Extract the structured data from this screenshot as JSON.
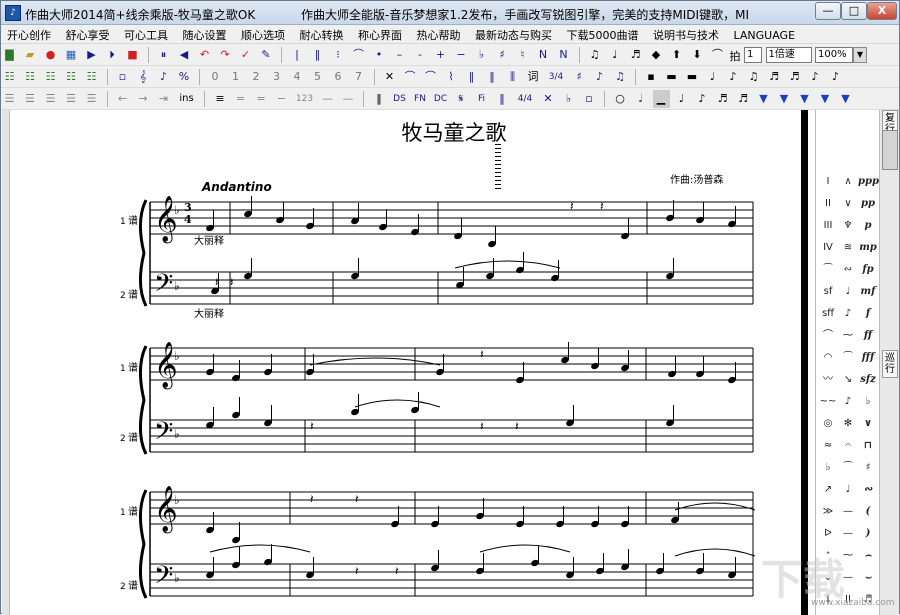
{
  "window": {
    "title_left": "作曲大师2014简+线余乘版-牧马童之歌OK",
    "title_right": "作曲大师全能版-音乐梦想家1.2发布，手画改写锐图引擎，完美的支持MIDI键歌，MI",
    "minimize_label": "—",
    "maximize_label": "□",
    "close_label": "X"
  },
  "menubar": {
    "items": [
      "开心创作",
      "舒心享受",
      "可心工具",
      "随心设置",
      "顺心选项",
      "耐心转换",
      "称心界面",
      "热心帮助",
      "最新动态与购买",
      "下载5000曲谱",
      "说明书与技术",
      "LANGUAGE"
    ]
  },
  "toolbar1": {
    "tempo_label": "拍",
    "tempo_value": "1",
    "speed_label": "1倍速",
    "zoom_value": "100%"
  },
  "toolbar2": {
    "digits": [
      "0",
      "1",
      "2",
      "3",
      "4",
      "5",
      "6",
      "7"
    ],
    "ci_label": "词",
    "ratio_label": "3/4"
  },
  "toolbar3": {
    "ins_label": "ins",
    "ratio_label": "4/4",
    "num_label": "123"
  },
  "score": {
    "title": "牧马童之歌",
    "composer": "作曲:汤普森",
    "tempo_marking": "Andantino",
    "system1": {
      "staff1_number": "1",
      "staff2_number": "2",
      "staff1_tag": "谱",
      "staff2_tag": "谱",
      "time_sig_top": "3",
      "time_sig_bottom": "4",
      "annotation1": "大丽释",
      "annotation2": "大丽释"
    },
    "system2": {
      "staff1_number": "1",
      "staff2_number": "2",
      "staff1_tag": "谱",
      "staff2_tag": "谱"
    },
    "system3": {
      "staff1_number": "1",
      "staff2_number": "2",
      "staff1_tag": "谱",
      "staff2_tag": "谱"
    }
  },
  "palette": {
    "items": [
      [
        "I",
        "∧",
        "ppp"
      ],
      [
        "II",
        "∨",
        "pp"
      ],
      [
        "III",
        "♆",
        "p"
      ],
      [
        "IV",
        "≋",
        "mp"
      ],
      [
        "⁀",
        "∾",
        "fp"
      ],
      [
        "sf",
        "♩",
        "mf"
      ],
      [
        "sff",
        "♪",
        "f"
      ],
      [
        "⌒",
        "⁓",
        "ff"
      ],
      [
        "◠",
        "⁀",
        "fff"
      ],
      [
        "〰",
        "↘",
        "sfz"
      ],
      [
        "~~",
        "♪",
        "♭"
      ],
      [
        "◎",
        "✻",
        "∨"
      ],
      [
        "≈",
        "𝄐",
        "⊓"
      ],
      [
        "♭",
        "⁀",
        "♯"
      ],
      [
        "↗",
        "♩",
        "∾"
      ],
      [
        "≫",
        "—",
        "("
      ],
      [
        "ᐅ",
        "—",
        ")"
      ],
      [
        "ᐩ",
        "⁓",
        "⌢"
      ],
      [
        "⌄",
        "—",
        "⌣"
      ],
      [
        "I",
        "II",
        "♬"
      ]
    ]
  },
  "sidetabs": {
    "tab1": "巡行",
    "tab2": "复行"
  },
  "watermark": {
    "glyph": "下载",
    "url": "www.xiazaiba.com"
  }
}
